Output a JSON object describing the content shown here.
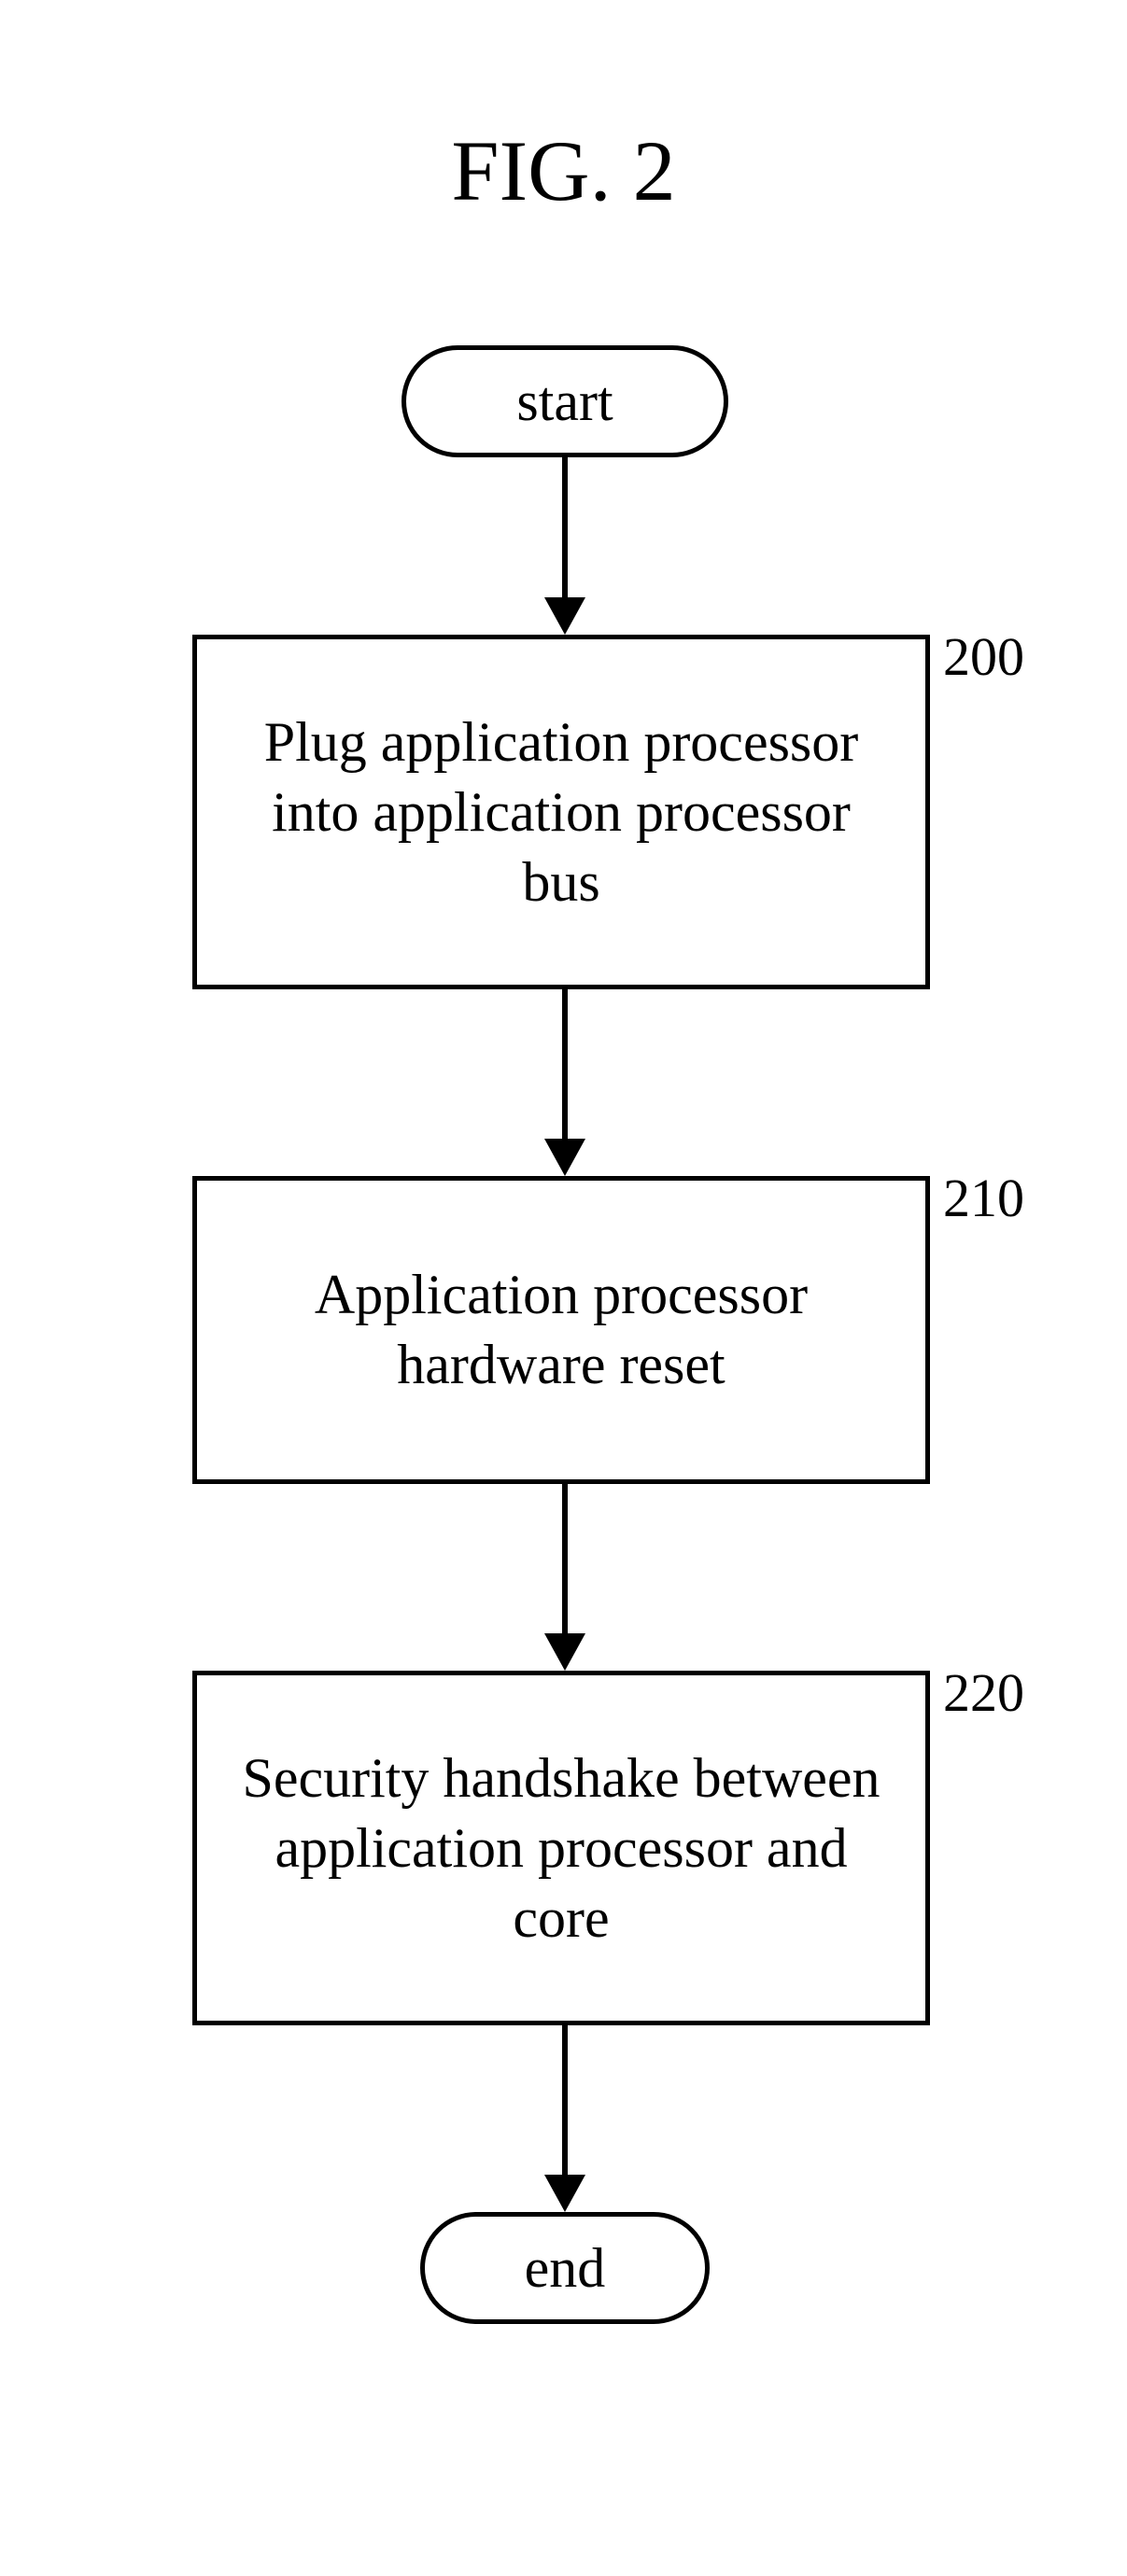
{
  "figure": {
    "title": "FIG. 2"
  },
  "flowchart": {
    "start": "start",
    "end": "end",
    "nodes": [
      {
        "ref": "200",
        "text": "Plug application processor into application processor bus"
      },
      {
        "ref": "210",
        "text": "Application processor hardware reset"
      },
      {
        "ref": "220",
        "text": "Security handshake between application processor and core"
      }
    ]
  }
}
